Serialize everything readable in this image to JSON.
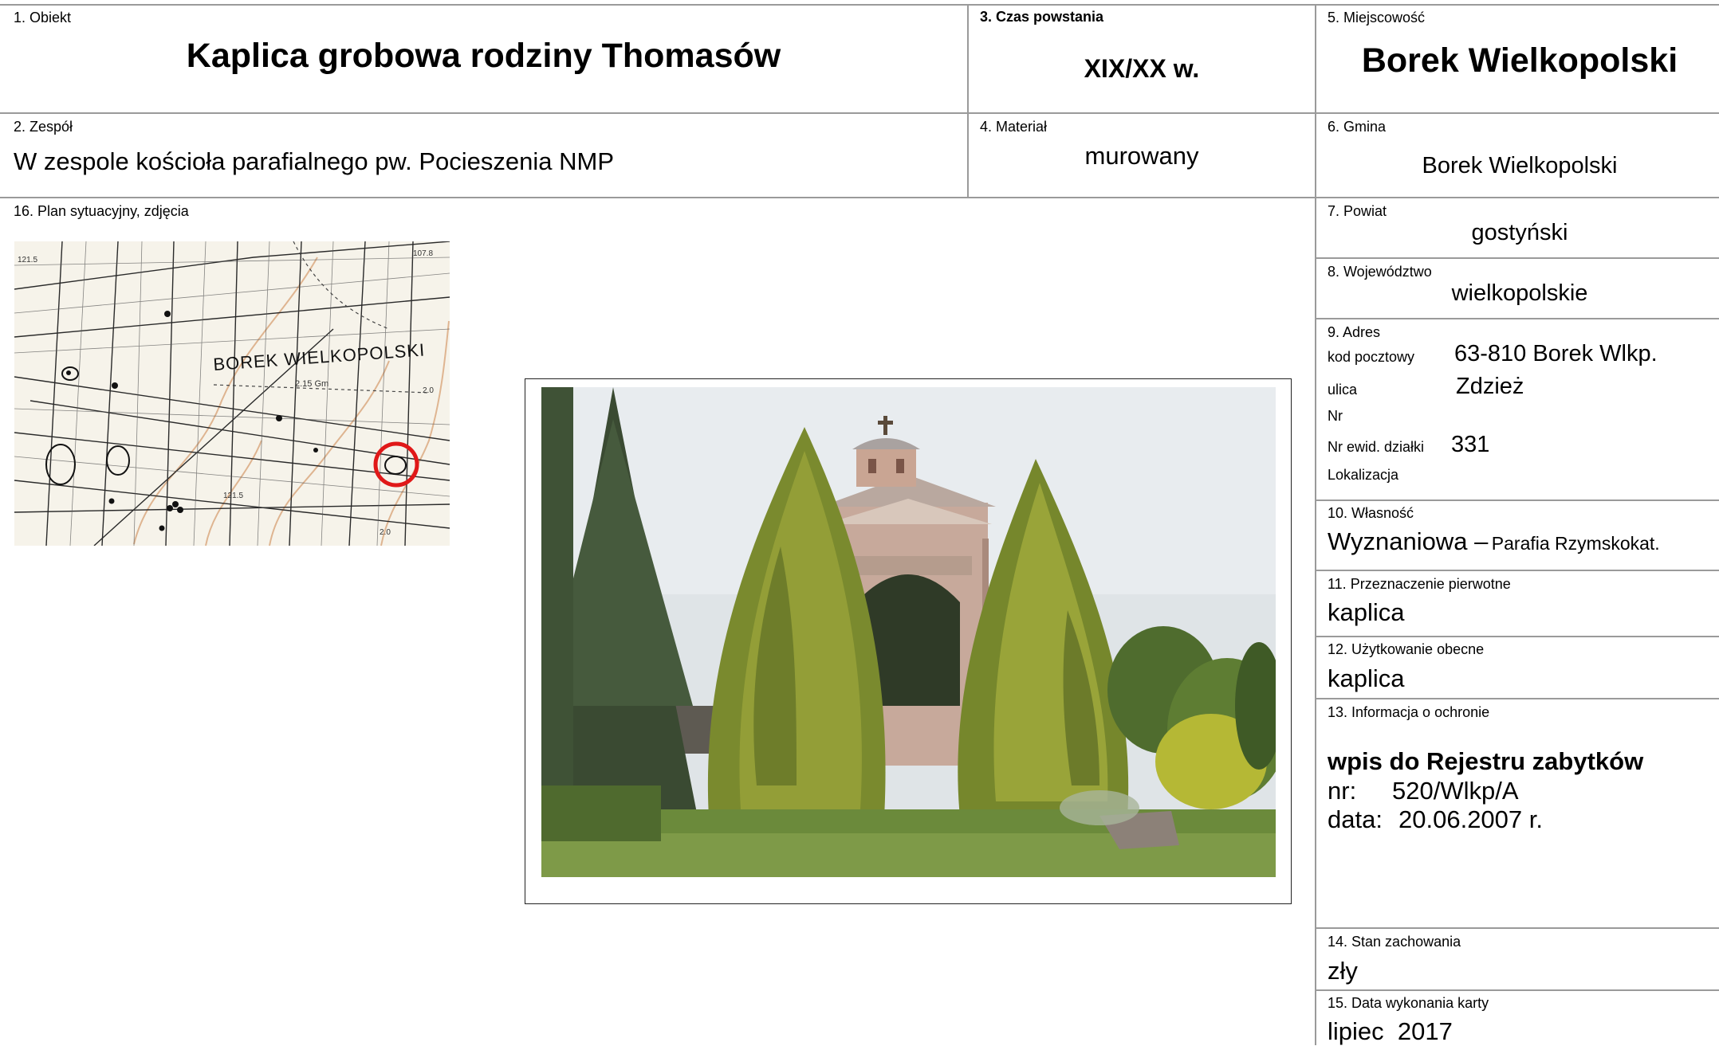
{
  "card": {
    "f1": {
      "label": "1. Obiekt",
      "value": "Kaplica grobowa rodziny Thomasów"
    },
    "f2": {
      "label": "2. Zespół",
      "value": "W zespole kościoła parafialnego pw. Pocieszenia NMP"
    },
    "f3": {
      "label": "3. Czas powstania",
      "value": "XIX/XX w."
    },
    "f4": {
      "label": "4. Materiał",
      "value": "murowany"
    },
    "f5": {
      "label": "5. Miejscowość",
      "value": "Borek Wielkopolski"
    },
    "f6": {
      "label": "6. Gmina",
      "value": "Borek Wielkopolski"
    },
    "f7": {
      "label": "7. Powiat",
      "value": "gostyński"
    },
    "f8": {
      "label": "8. Województwo",
      "value": "wielkopolskie"
    },
    "f9": {
      "label": "9. Adres",
      "kod_label": "kod pocztowy",
      "kod_value": "63-810 Borek Wlkp.",
      "ulica_label": "ulica",
      "ulica_value": "Zdzież",
      "nr_label": "Nr",
      "dzialka_label": "Nr ewid. działki",
      "dzialka_value": "331",
      "lokalizacja_label": "Lokalizacja"
    },
    "f10": {
      "label": "10. Własność",
      "value_main": "Wyznaniowa –",
      "value_sub": "Parafia Rzymskokat."
    },
    "f11": {
      "label": "11. Przeznaczenie pierwotne",
      "value": "kaplica"
    },
    "f12": {
      "label": "12. Użytkowanie obecne",
      "value": "kaplica"
    },
    "f13": {
      "label": "13. Informacja o ochronie",
      "heading": "wpis do Rejestru zabytków",
      "nr_label": "nr:",
      "nr_value": "520/Wlkp/A",
      "data_label": "data:",
      "data_value": "20.06.2007 r."
    },
    "f14": {
      "label": "14. Stan zachowania",
      "value": "zły"
    },
    "f15": {
      "label": "15. Data wykonania karty",
      "value": "lipiec  2017"
    },
    "f16": {
      "label": "16. Plan sytuacyjny, zdjęcia"
    }
  },
  "map": {
    "town_label": "BOREK WIELKOPOLSKI",
    "spot_heights": [
      "121.5",
      "107.8",
      "2.15 Gm",
      "121.5",
      "2.0",
      "2.0"
    ],
    "marker_color": "#e01818"
  },
  "colors": {
    "grid_line": "#9a9a9a"
  }
}
